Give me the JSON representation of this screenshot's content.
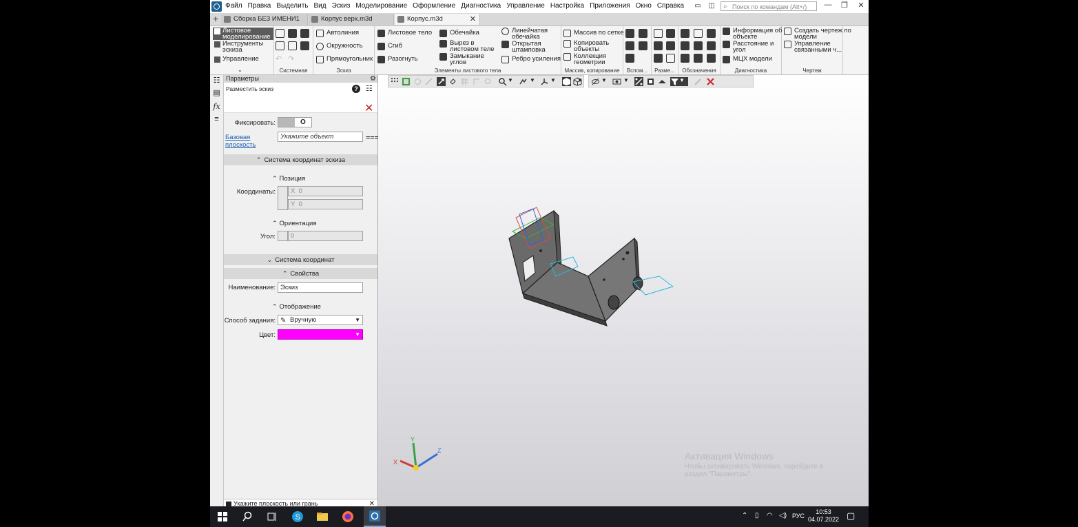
{
  "menu": [
    "Файл",
    "Правка",
    "Выделить",
    "Вид",
    "Эскиз",
    "Моделирование",
    "Оформление",
    "Диагностика",
    "Управление",
    "Настройка",
    "Приложения",
    "Окно",
    "Справка"
  ],
  "search_placeholder": "Поиск по командам (Alt+/)",
  "tabs": [
    {
      "label": "Сборка БЕЗ ИМЕНИ1",
      "active": false
    },
    {
      "label": "Корпус верх.m3d",
      "active": false
    },
    {
      "label": "Корпус.m3d",
      "active": true
    }
  ],
  "ribbon": {
    "modes": [
      {
        "label": "Листовое моделирование",
        "selected": true
      },
      {
        "label": "Инструменты эскиза",
        "selected": false
      },
      {
        "label": "Управление",
        "selected": false
      }
    ],
    "groups": {
      "sistemnaya": "Системная",
      "eskiz": "Эскиз",
      "elementy": "Элементы листового тела",
      "massiv": "Массив, копирование",
      "vspom": "Вспом...",
      "razme": "Разме...",
      "oboznacheniya": "Обозначения",
      "diagnostika": "Диагностика",
      "chertezh": "Чертеж"
    },
    "sketch_tools": [
      "Автолиния",
      "Окружность",
      "Прямоугольник"
    ],
    "sheet_tools": [
      "Листовое тело",
      "Сгиб",
      "Разогнуть",
      "Обечайка",
      "Вырез в листовом теле",
      "Замыкание углов",
      "Линейчатая обечайка",
      "Открытая штамповка",
      "Ребро усиления"
    ],
    "array_tools": [
      "Массив по сетке",
      "Копировать объекты",
      "Коллекция геометрии"
    ],
    "diag_tools": [
      "Информация об объекте",
      "Расстояние и угол",
      "МЦХ модели"
    ],
    "drawing_tools": [
      "Создать чертеж по модели",
      "Управление связанными ч..."
    ]
  },
  "panel": {
    "title": "Параметры",
    "operation": "Разместить эскиз",
    "fix_label": "Фиксировать:",
    "fix_value": "O",
    "base_plane_label": "Базовая плоскость",
    "base_plane_value": "Укажите объект",
    "sections": {
      "sketch_cs": "Система координат эскиза",
      "position": "Позиция",
      "orientation": "Ориентация",
      "cs": "Система координат",
      "props": "Свойства",
      "display": "Отображение"
    },
    "coords_label": "Координаты:",
    "x_label": "X",
    "x_value": "0",
    "y_label": "Y",
    "y_value": "0",
    "angle_label": "Угол:",
    "angle_value": "0",
    "name_label": "Наименование:",
    "name_value": "Эскиз",
    "method_label": "Способ задания:",
    "method_value": "Вручную",
    "color_label": "Цвет:",
    "color_value": "#ff00ff",
    "status": "Укажите плоскость или грань"
  },
  "watermark": {
    "title": "Активация Windows",
    "sub1": "Чтобы активировать Windows, перейдите в",
    "sub2": "раздел \"Параметры\"."
  },
  "axes": {
    "x": "X",
    "y": "Y",
    "z": "Z"
  },
  "taskbar": {
    "lang": "РУС",
    "time": "10:53",
    "date": "04.07.2022"
  }
}
